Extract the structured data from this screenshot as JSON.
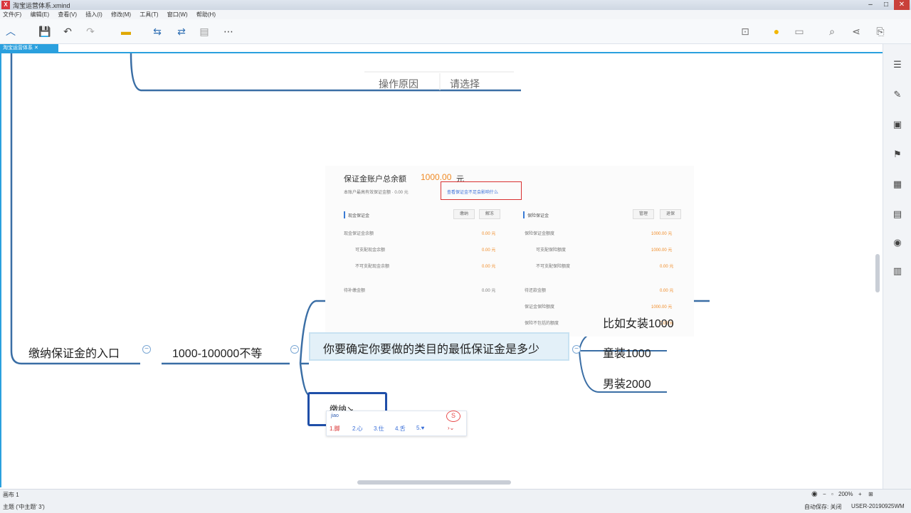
{
  "window": {
    "title": "淘宝运营体系.xmind"
  },
  "menu": [
    "文件(F)",
    "编辑(E)",
    "查看(V)",
    "插入(I)",
    "修改(M)",
    "工具(T)",
    "窗口(W)",
    "帮助(H)"
  ],
  "doc_tab": "淘宝运营体系 ✕",
  "top_table": {
    "col1": "操作原因",
    "col2": "请选择"
  },
  "shot": {
    "heading": "保证金账户总余额",
    "amount": "1000.00",
    "unit": "元",
    "subline": "本账户最高有效保证金额 · 0.00 元",
    "link": "查看保证金不足会影响什么",
    "left_title": "现金保证金",
    "left_btn1": "缴纳",
    "left_btn2": "解冻",
    "right_title": "保险保证金",
    "right_btn1": "管理",
    "right_btn2": "退保",
    "left_rows": [
      {
        "label": "现金保证金余额",
        "value": "0.00 元"
      },
      {
        "label": "可支配现金余额",
        "value": "0.00 元"
      },
      {
        "label": "不可支配现金余额",
        "value": "0.00 元"
      },
      {
        "label": "待补缴金额",
        "value": "0.00 元"
      }
    ],
    "right_rows": [
      {
        "label": "保险保证金额度",
        "value": "1000.00 元"
      },
      {
        "label": "可支配保险额度",
        "value": "1000.00 元"
      },
      {
        "label": "不可支配保险额度",
        "value": "0.00 元"
      },
      {
        "label": "待还款金额",
        "value": "0.00 元"
      },
      {
        "label": "保证金保险额度",
        "value": "1000.00 元"
      },
      {
        "label": "保险不包括的额度",
        "value": "0.00 元"
      }
    ]
  },
  "mindmap": {
    "root": "缴纳保证金的入口",
    "range": "1000-100000不等",
    "category": "你要确定你要做的类目的最低保证金是多少",
    "examples": [
      "比如女装1000",
      "童装1000",
      "男装2000"
    ],
    "editing": "缴纳↘"
  },
  "ime": {
    "input": "jiao",
    "candidates": [
      "1.脚",
      "2.心",
      "3.仕",
      "4.舌",
      "5.♥"
    ]
  },
  "status": {
    "left_top": "画布 1",
    "left_bottom": "主题 ('中主题' 3')",
    "zoom": "200%",
    "autosave": "自动保存: 关闭",
    "user": "USER-20190925WM"
  },
  "colors": {
    "accent": "#2aa0de",
    "line": "#3a6ea5",
    "orange": "#f08a24"
  }
}
